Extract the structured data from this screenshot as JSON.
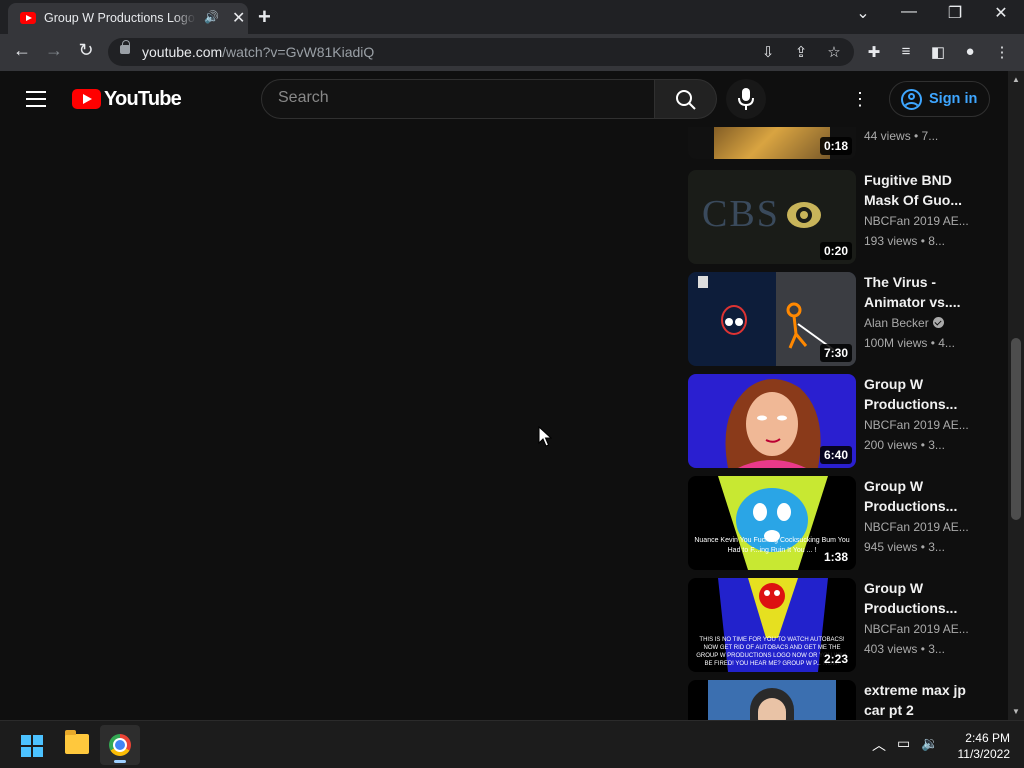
{
  "browser": {
    "tab_title": "Group W Productions Logo",
    "tab_audio_icon": "speaker-icon",
    "url_host": "youtube.com",
    "url_path": "/watch?v=GvW81KiadiQ"
  },
  "youtube": {
    "logo_text": "YouTube",
    "search_placeholder": "Search",
    "signin_label": "Sign in"
  },
  "related": [
    {
      "title": "",
      "channel": "",
      "meta": "44 views • 7...",
      "duration": "0:18"
    },
    {
      "title": "Fugitive BND Mask Of Guo...",
      "channel": "NBCFan 2019 AE...",
      "meta": "193 views • 8...",
      "duration": "0:20",
      "thumb_text": "CBS"
    },
    {
      "title": "The Virus - Animator vs....",
      "channel": "Alan Becker",
      "verified": true,
      "meta": "100M views • 4...",
      "duration": "7:30"
    },
    {
      "title": "Group W Productions...",
      "channel": "NBCFan 2019 AE...",
      "meta": "200 views • 3...",
      "duration": "6:40"
    },
    {
      "title": "Group W Productions...",
      "channel": "NBCFan 2019 AE...",
      "meta": "945 views • 3...",
      "duration": "1:38",
      "thumb_text": "Nuance Kevin You Fucking Cocksucking Bum You Had to F...ing Ruin It You ... !"
    },
    {
      "title": "Group W Productions...",
      "channel": "NBCFan 2019 AE...",
      "meta": "403 views • 3...",
      "duration": "2:23",
      "thumb_text": "THIS IS NO TIME FOR YOU TO WATCH AUTOBACS! NOW GET RID OF AUTOBACS AND GET ME THE GROUP W PRODUCTIONS LOGO NOW OR YOU WILL BE FIRED! YOU HEAR ME? GROUP W P... NOW!"
    },
    {
      "title": "extreme max jp car pt 2",
      "channel": "",
      "meta": "",
      "duration": ""
    }
  ],
  "taskbar": {
    "time": "2:46 PM",
    "date": "11/3/2022"
  },
  "colors": {
    "yt_red": "#ff0000",
    "link_blue": "#3ea6ff",
    "background": "#0f0f0f"
  }
}
